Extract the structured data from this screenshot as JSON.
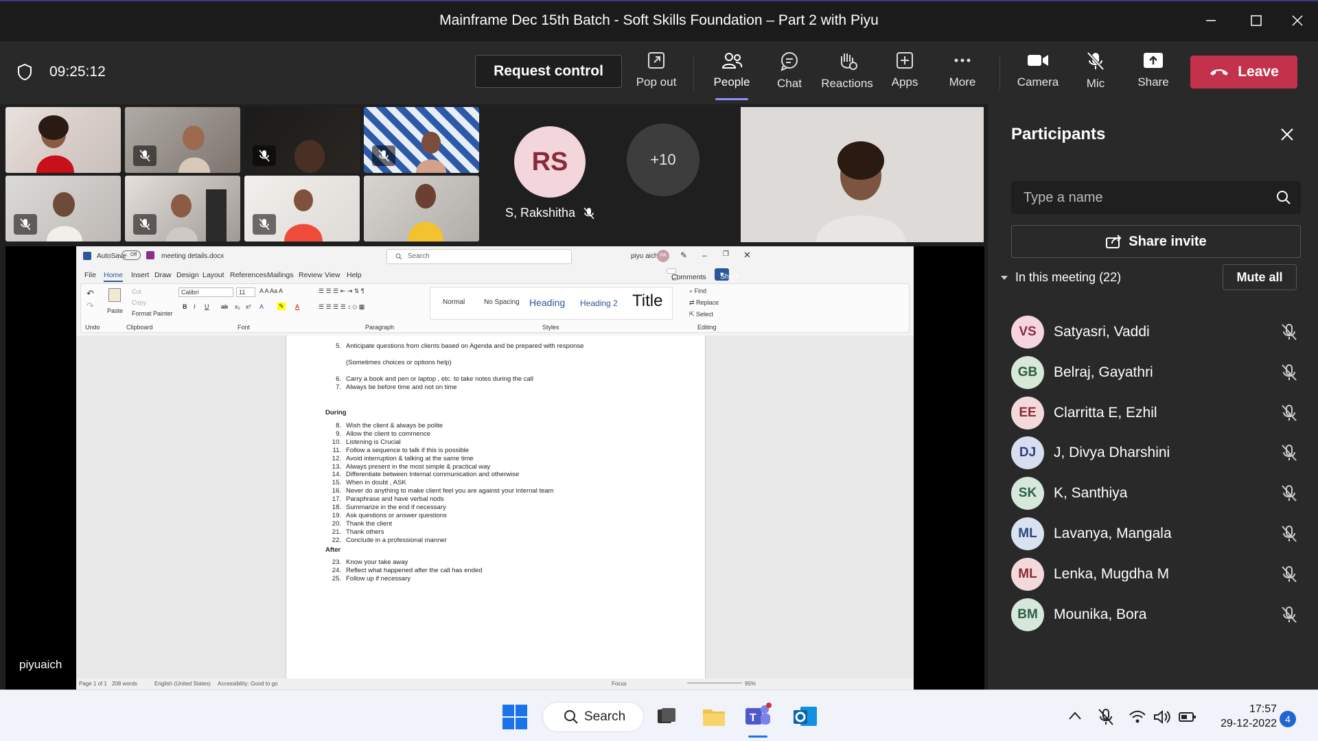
{
  "window": {
    "title": "Mainframe Dec 15th Batch - Soft Skills Foundation – Part 2 with Piyu"
  },
  "toolbar": {
    "timer": "09:25:12",
    "request_control": "Request control",
    "pop_out": "Pop out",
    "people": "People",
    "chat": "Chat",
    "reactions": "Reactions",
    "apps": "Apps",
    "more": "More",
    "camera": "Camera",
    "mic": "Mic",
    "share": "Share",
    "leave": "Leave"
  },
  "stage": {
    "avatar_initials": "RS",
    "avatar_name": "S, Rakshitha",
    "overflow_count": "+10",
    "presenter_name": "piyuaich"
  },
  "word": {
    "autosave": "AutoSave",
    "autosave_state": "Off",
    "filename": "meeting details.docx",
    "search": "Search",
    "user": "piyu aich",
    "user_initials": "PA",
    "tabs": [
      "File",
      "Home",
      "Insert",
      "Draw",
      "Design",
      "Layout",
      "References",
      "Mailings",
      "Review",
      "View",
      "Help"
    ],
    "comments": "Comments",
    "share": "Share",
    "font_name": "Calibri",
    "font_size": "11",
    "groups": {
      "undo": "Undo",
      "clipboard": "Clipboard",
      "font": "Font",
      "paragraph": "Paragraph",
      "styles": "Styles",
      "editing": "Editing"
    },
    "clipboard": {
      "paste": "Paste",
      "cut": "Cut",
      "copy": "Copy",
      "format_painter": "Format Painter"
    },
    "styles": [
      "Normal",
      "No Spacing",
      "Heading",
      "Heading 2",
      "Title"
    ],
    "editing": {
      "find": "Find",
      "replace": "Replace",
      "select": "Select"
    },
    "doc": {
      "lines_before": [
        {
          "n": "5.",
          "t": "Anticipate questions from clients based on Agenda and be prepared with response"
        },
        {
          "n": "",
          "t": "(Sometimes choices or options help)"
        },
        {
          "n": "6.",
          "t": "Carry a book and pen or laptop , etc. to take notes during the call"
        },
        {
          "n": "7.",
          "t": "Always be before time and not on time"
        }
      ],
      "heading_during": "During",
      "lines_during": [
        {
          "n": "8.",
          "t": "Wish the client & always be polite"
        },
        {
          "n": "9.",
          "t": "Allow the client to commence"
        },
        {
          "n": "10.",
          "t": "Listening is Crucial"
        },
        {
          "n": "11.",
          "t": "Follow a sequence to talk if this is possible"
        },
        {
          "n": "12.",
          "t": "Avoid interruption & talking at the same time"
        },
        {
          "n": "13.",
          "t": "Always present in the most simple & practical way"
        },
        {
          "n": "14.",
          "t": "Differentiate between Internal communication and otherwise"
        },
        {
          "n": "15.",
          "t": "When in doubt , ASK"
        },
        {
          "n": "16.",
          "t": "Never do anything to make client feel you are against your internal team"
        },
        {
          "n": "17.",
          "t": "Paraphrase and have verbal nods"
        },
        {
          "n": "18.",
          "t": "Summarize in the end if necessary"
        },
        {
          "n": "19.",
          "t": "Ask questions or answer questions"
        },
        {
          "n": "20.",
          "t": "Thank the client"
        },
        {
          "n": "21.",
          "t": "Thank others"
        },
        {
          "n": "22.",
          "t": "Conclude in a professional manner"
        }
      ],
      "heading_after": "After",
      "lines_after": [
        {
          "n": "23.",
          "t": "Know your take away"
        },
        {
          "n": "24.",
          "t": "Reflect what happened after the call has ended"
        },
        {
          "n": "25.",
          "t": "Follow up if necessary"
        }
      ]
    },
    "status": {
      "page": "Page 1 of 1",
      "words": "208 words",
      "language": "English (United States)",
      "accessibility": "Accessibility: Good to go",
      "focus": "Focus",
      "zoom": "95%"
    }
  },
  "panel": {
    "title": "Participants",
    "search_placeholder": "Type a name",
    "share_invite": "Share invite",
    "in_meeting": "In this meeting (22)",
    "mute_all": "Mute all",
    "participants": [
      {
        "initials": "VS",
        "name": "Satyasri, Vaddi",
        "bg": "#f6d6de",
        "fg": "#8a2a44"
      },
      {
        "initials": "GB",
        "name": "Belraj, Gayathri",
        "bg": "#d8e8d8",
        "fg": "#2d5a3a"
      },
      {
        "initials": "EE",
        "name": "Clarritta E, Ezhil",
        "bg": "#f4d9dc",
        "fg": "#8a2c38"
      },
      {
        "initials": "DJ",
        "name": "J, Divya Dharshini",
        "bg": "#d8def0",
        "fg": "#2f3f7a"
      },
      {
        "initials": "SK",
        "name": "K, Santhiya",
        "bg": "#d6e8dc",
        "fg": "#2e5e44"
      },
      {
        "initials": "ML",
        "name": "Lavanya, Mangala",
        "bg": "#d9e2f0",
        "fg": "#2d4578"
      },
      {
        "initials": "ML",
        "name": "Lenka, Mugdha M",
        "bg": "#f4d9dc",
        "fg": "#8a2c38"
      },
      {
        "initials": "BM",
        "name": "Mounika, Bora",
        "bg": "#d6e8dc",
        "fg": "#2e5e44"
      }
    ]
  },
  "taskbar": {
    "search": "Search",
    "time": "17:57",
    "date": "29-12-2022",
    "notifications": "4"
  }
}
